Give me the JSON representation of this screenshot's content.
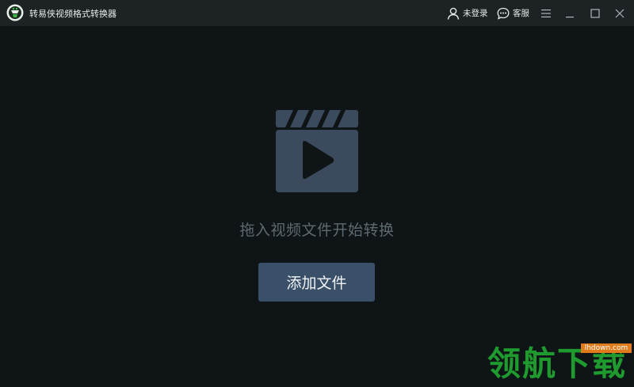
{
  "titlebar": {
    "app_title": "转易侠视频格式转换器",
    "login_label": "未登录",
    "service_label": "客服"
  },
  "main": {
    "drop_hint": "拖入视频文件开始转换",
    "add_file_label": "添加文件"
  },
  "watermark": {
    "text": "领航下载",
    "url": "lhdown.com"
  },
  "icons": {
    "logo": "app-logo-icon",
    "user": "user-icon",
    "chat": "chat-bubble-icon",
    "menu": "hamburger-menu-icon",
    "minimize": "minimize-icon",
    "maximize": "maximize-icon",
    "close": "close-icon",
    "video": "video-clapperboard-icon"
  },
  "colors": {
    "background": "#0f1516",
    "titlebar": "#1d2325",
    "button": "#3a5068",
    "icon": "#3b4a5c",
    "hint_text": "#5e6a71",
    "watermark_green": "#1f9a2e",
    "watermark_orange": "#e07b1c"
  }
}
